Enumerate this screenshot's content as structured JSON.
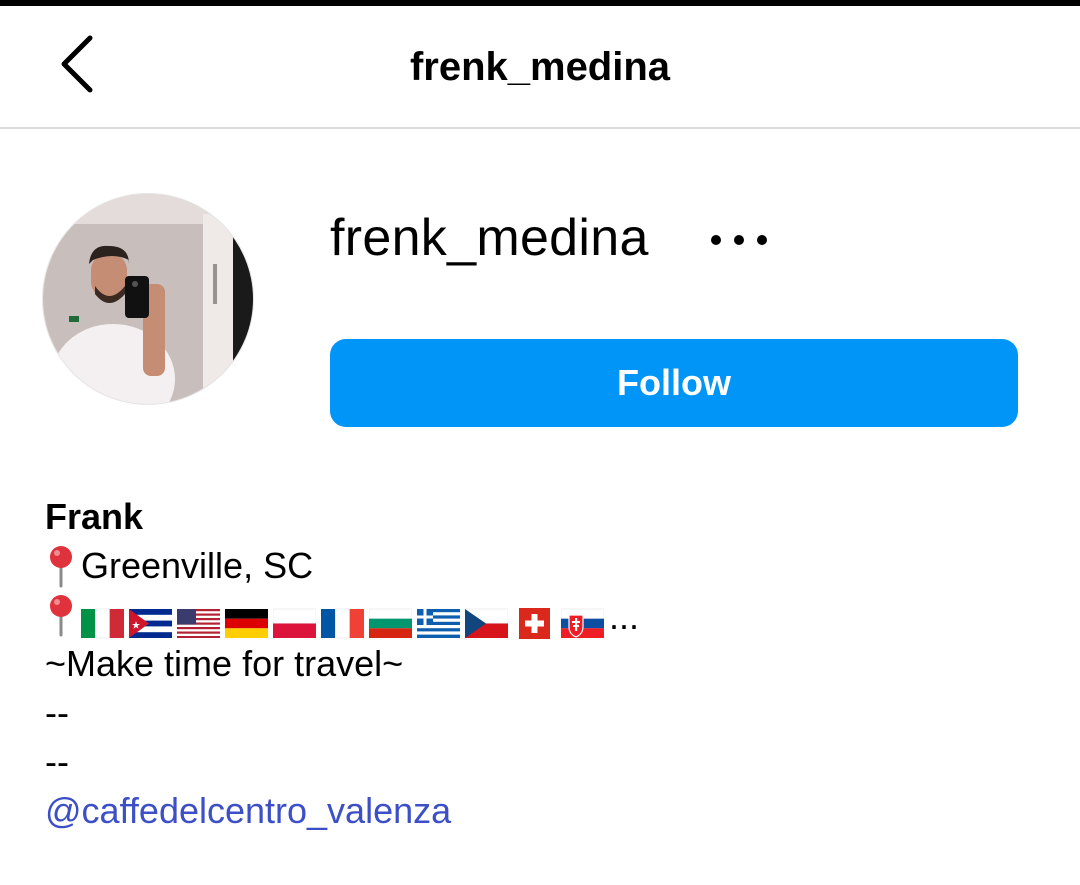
{
  "header": {
    "back_icon": "chevron-left-icon",
    "title": "frenk_medina"
  },
  "profile": {
    "username": "frenk_medina",
    "more_icon": "more-horizontal-icon",
    "follow_label": "Follow",
    "follow_color": "#0095f6"
  },
  "bio": {
    "name": "Frank",
    "location_icon": "round-pushpin-icon",
    "location": "Greenville, SC",
    "flags": [
      "italy",
      "cuba",
      "united-states",
      "germany",
      "poland",
      "france",
      "bulgaria",
      "greece",
      "czech-republic",
      "switzerland",
      "slovakia"
    ],
    "flags_suffix": "...",
    "tagline": "~Make time for travel~",
    "separator_1": "--",
    "separator_2": "--",
    "mention": "@caffedelcentro_valenza",
    "mention_color": "#3c4fc7"
  }
}
